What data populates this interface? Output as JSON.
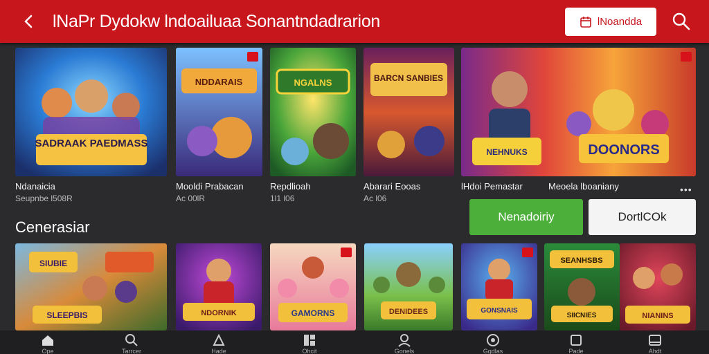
{
  "header": {
    "title": "lNaPr Dydokw lndoailuaa Sonantndadrarion",
    "action_label": "lNoandda",
    "colors": {
      "bar": "#c8161d",
      "button_text": "#c8161d"
    }
  },
  "featured": [
    {
      "title": "Ndanaicia",
      "sub": "Seupnbe l508R",
      "art": "SADRAAK PAEDMASS",
      "badge": false
    },
    {
      "title": "Mooldi Prabacan",
      "sub": "Ac 00lR",
      "art": "NDDARAIS",
      "badge": true
    },
    {
      "title": "Repdlioah",
      "sub": "1l1 l06",
      "art": "NGALNS",
      "badge": false
    },
    {
      "title": "Abarari Eooas",
      "sub": "Ac l06",
      "art": "BARCN SANBIES",
      "badge": false
    },
    {
      "title": "lHdoi Pemastar",
      "sub": "",
      "art": "NEHNUKS",
      "badge": true
    },
    {
      "title": "Meoela lboaniany",
      "sub": "",
      "art": "DOONORS",
      "badge": false
    }
  ],
  "more_label": "•••",
  "buttons": {
    "primary": "Nenadoiriy",
    "secondary": "DortlCOk"
  },
  "section_title": "Cenerasiar",
  "grid": [
    {
      "art1": "SIUBIE",
      "art2": "SLEEPBIS",
      "badge": false
    },
    {
      "art1": "NDORNIK",
      "art2": "",
      "badge": false
    },
    {
      "art1": "GAMORNS",
      "art2": "",
      "badge": true
    },
    {
      "art1": "DENIDEES",
      "art2": "",
      "badge": false
    },
    {
      "art1": "GONSNAIS",
      "art2": "",
      "badge": true
    },
    {
      "art1": "SEANHSBS",
      "art2": "SIICNIES",
      "badge": false
    },
    {
      "art1": "NIANINS",
      "art2": "",
      "badge": false
    }
  ],
  "nav": [
    {
      "icon": "home-icon",
      "label": "Ope"
    },
    {
      "icon": "search-icon",
      "label": "Tarrcer"
    },
    {
      "icon": "controller-icon",
      "label": "Hade"
    },
    {
      "icon": "grid-icon",
      "label": "Ohcit"
    },
    {
      "icon": "user-icon",
      "label": "Gonels"
    },
    {
      "icon": "shield-icon",
      "label": "Ggdlas"
    },
    {
      "icon": "square-icon",
      "label": "Pade"
    },
    {
      "icon": "card-icon",
      "label": "Ahdt"
    }
  ]
}
